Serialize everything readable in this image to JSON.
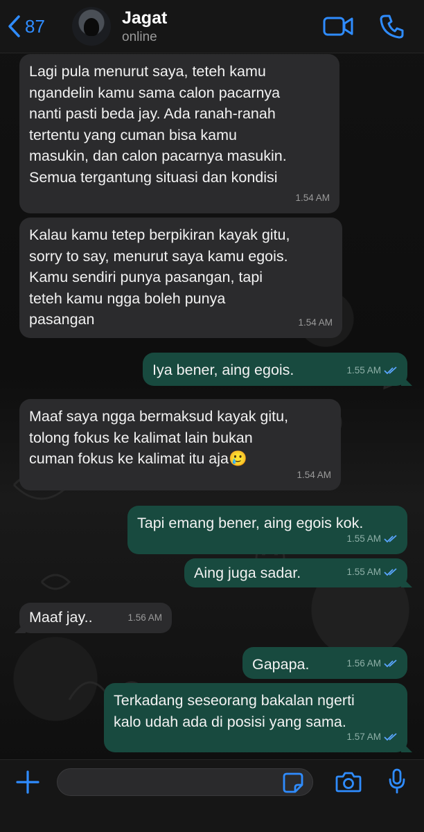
{
  "header": {
    "back_count": "87",
    "contact_name": "Jagat",
    "contact_status": "online"
  },
  "icons": {
    "back": "chevron-left-icon",
    "video": "video-camera-icon",
    "call": "phone-icon",
    "attach": "plus-icon",
    "sticker": "sticker-icon",
    "camera": "camera-icon",
    "mic": "microphone-icon"
  },
  "colors": {
    "accent": "#2f8cff",
    "incoming_bubble": "#2b2b2d",
    "outgoing_bubble": "#184a3f",
    "read_ticks": "#5aa6ff"
  },
  "messages": [
    {
      "direction": "in",
      "text": "Lagi pula menurut saya, teteh kamu\nngandelin kamu sama calon pacarnya\nnanti pasti beda jay. Ada ranah-ranah\ntertentu yang cuman bisa kamu\nmasukin, dan calon pacarnya masukin.\nSemua tergantung situasi dan kondisi",
      "time": "1.54 AM"
    },
    {
      "direction": "in",
      "text": "Kalau kamu tetep berpikiran kayak gitu,\nsorry to say, menurut saya kamu egois.\nKamu sendiri punya pasangan, tapi\nteteh kamu ngga boleh punya\npasangan",
      "time": "1.54 AM"
    },
    {
      "direction": "out",
      "text": "Iya bener, aing egois.",
      "time": "1.55 AM",
      "status": "read"
    },
    {
      "direction": "in",
      "text": "Maaf saya ngga bermaksud kayak gitu,\ntolong fokus ke kalimat lain bukan\ncuman fokus ke kalimat itu aja🥲",
      "time": "1.54 AM"
    },
    {
      "direction": "out",
      "text": "Tapi emang bener, aing egois kok.",
      "time": "1.55 AM",
      "status": "read"
    },
    {
      "direction": "out",
      "text": "Aing juga sadar.",
      "time": "1.55 AM",
      "status": "read"
    },
    {
      "direction": "in",
      "text": "Maaf jay..",
      "time": "1.56 AM"
    },
    {
      "direction": "out",
      "text": "Gapapa.",
      "time": "1.56 AM",
      "status": "read"
    },
    {
      "direction": "out",
      "text": "Terkadang seseorang bakalan ngerti\nkalo udah ada di posisi yang sama.",
      "time": "1.57 AM",
      "status": "read"
    }
  ],
  "composer": {
    "value": "",
    "placeholder": ""
  }
}
